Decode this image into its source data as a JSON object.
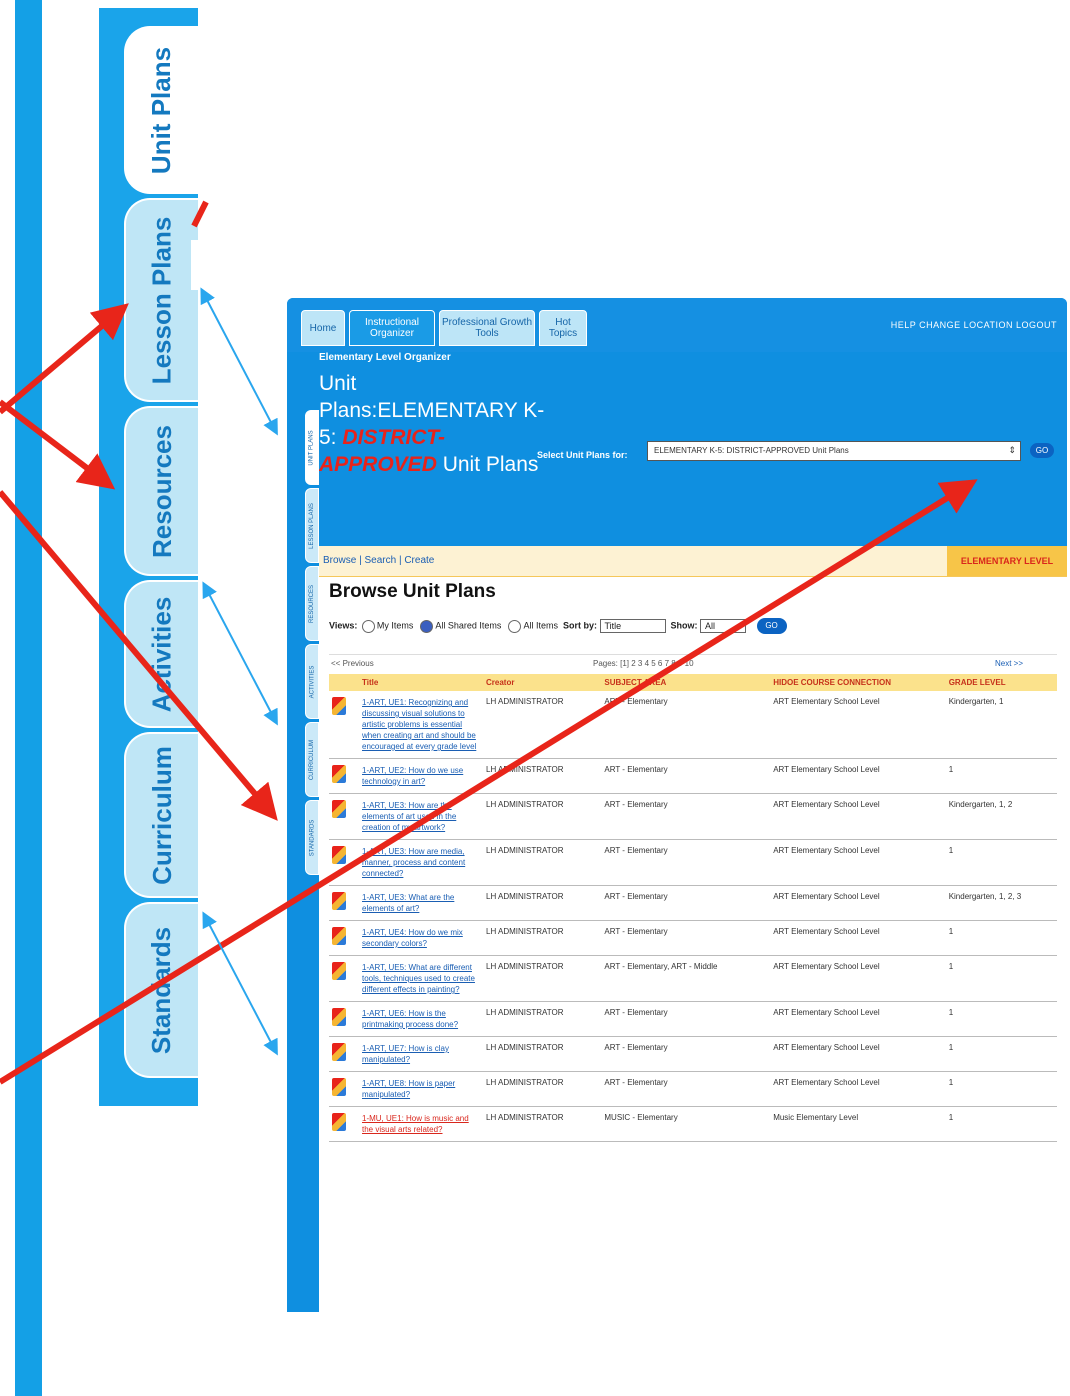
{
  "side_tabs": [
    "Unit Plans",
    "Lesson Plans",
    "Resources",
    "Activities",
    "Curriculum",
    "Standards"
  ],
  "app": {
    "nav_tabs": [
      "Home",
      "Instructional Organizer",
      "Professional Growth Tools",
      "Hot Topics"
    ],
    "top_links": "HELP   CHANGE LOCATION   LOGOUT",
    "level_label": "Elementary Level Organizer",
    "title_pre": "Unit Plans:ELEMENTARY K-5: ",
    "title_red": "DISTRICT-APPROVED",
    "title_post": " Unit Plans",
    "select_label": "Select Unit Plans for:",
    "select_value": "ELEMENTARY K-5: DISTRICT-APPROVED Unit Plans",
    "go_label": "GO",
    "mini_tabs": [
      "UNIT PLANS",
      "LESSON PLANS",
      "RESOURCES",
      "ACTIVITIES",
      "CURRICULUM",
      "STANDARDS"
    ],
    "subnav": "Browse | Search | Create",
    "level_badge": "ELEMENTARY LEVEL",
    "browse_heading": "Browse Unit Plans",
    "views": {
      "label": "Views:",
      "opt1": "My Items",
      "opt2": "All Shared Items",
      "opt3": "All Items",
      "sort_label": "Sort by:",
      "sort_value": "Title",
      "show_label": "Show:",
      "show_value": "All",
      "go": "GO"
    },
    "pager": {
      "prev": "<< Previous",
      "pages": "Pages: [1] 2 3 4 5 6 7 8 9 10",
      "next": "Next >>"
    },
    "columns": [
      "Title",
      "Creator",
      "SUBJECT AREA",
      "HIDOE COURSE CONNECTION",
      "GRADE LEVEL"
    ],
    "rows": [
      {
        "title": "1-ART, UE1: Recognizing and discussing visual solutions to artistic problems is essential when creating art and should be encouraged at every grade level",
        "creator": "LH ADMINISTRATOR",
        "subject": "ART - Elementary",
        "course": "ART Elementary School Level",
        "grade": "Kindergarten, 1",
        "red": false
      },
      {
        "title": "1-ART, UE2: How do we use technology in art?",
        "creator": "LH ADMINISTRATOR",
        "subject": "ART - Elementary",
        "course": "ART Elementary School Level",
        "grade": "1",
        "red": false
      },
      {
        "title": "1-ART, UE3: How are the elements of art used in the creation of my artwork?",
        "creator": "LH ADMINISTRATOR",
        "subject": "ART - Elementary",
        "course": "ART Elementary School Level",
        "grade": "Kindergarten, 1, 2",
        "red": false
      },
      {
        "title": "1-ART, UE3: How are media, manner, process and content connected?",
        "creator": "LH ADMINISTRATOR",
        "subject": "ART - Elementary",
        "course": "ART Elementary School Level",
        "grade": "1",
        "red": false
      },
      {
        "title": "1-ART, UE3: What are the elements of art?",
        "creator": "LH ADMINISTRATOR",
        "subject": "ART - Elementary",
        "course": "ART Elementary School Level",
        "grade": "Kindergarten, 1, 2, 3",
        "red": false
      },
      {
        "title": "1-ART, UE4: How do we mix secondary colors?",
        "creator": "LH ADMINISTRATOR",
        "subject": "ART - Elementary",
        "course": "ART Elementary School Level",
        "grade": "1",
        "red": false
      },
      {
        "title": "1-ART, UE5: What are different tools, techniques used to create different effects in painting?",
        "creator": "LH ADMINISTRATOR",
        "subject": "ART - Elementary, ART - Middle",
        "course": "ART Elementary School Level",
        "grade": "1",
        "red": false
      },
      {
        "title": "1-ART, UE6: How is the printmaking process done?",
        "creator": "LH ADMINISTRATOR",
        "subject": "ART - Elementary",
        "course": "ART Elementary School Level",
        "grade": "1",
        "red": false
      },
      {
        "title": "1-ART, UE7: How is clay manipulated?",
        "creator": "LH ADMINISTRATOR",
        "subject": "ART - Elementary",
        "course": "ART Elementary School Level",
        "grade": "1",
        "red": false
      },
      {
        "title": "1-ART, UE8: How is paper manipulated?",
        "creator": "LH ADMINISTRATOR",
        "subject": "ART - Elementary",
        "course": "ART Elementary School Level",
        "grade": "1",
        "red": false
      },
      {
        "title": "1-MU, UE1: How is music and the visual arts related?",
        "creator": "LH ADMINISTRATOR",
        "subject": "MUSIC - Elementary",
        "course": "Music Elementary Level",
        "grade": "1",
        "red": true
      }
    ]
  }
}
